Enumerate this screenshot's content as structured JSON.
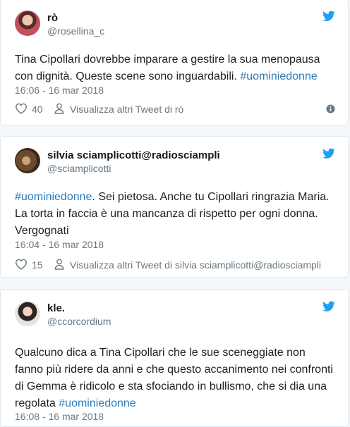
{
  "colors": {
    "link": "#2b7bb9",
    "twitter_blue": "#1da1f2",
    "muted": "#697882"
  },
  "icons": {
    "bird": "twitter-bird-icon",
    "like": "heart-icon",
    "profile": "person-icon",
    "info": "info-icon"
  },
  "tweets": [
    {
      "name": "rò",
      "handle": "@rosellina_c",
      "text_before": "Tina Cipollari dovrebbe imparare a gestire la sua menopausa con dignità. Queste scene sono inguardabili. ",
      "hashtag": "#uominiedonne",
      "text_after": "",
      "time": "16:06 - 16 mar 2018",
      "likes": "40",
      "more_link": "Visualizza altri Tweet di rò"
    },
    {
      "name": "silvia sciamplicotti@radiosciampli",
      "handle": "@sciamplicotti",
      "hashtag": "#uominiedonne",
      "text_after": ". Sei pietosa. Anche tu Cipollari ringrazia Maria. La torta in faccia è una mancanza di rispetto per ogni donna. Vergognati",
      "time": "16:04 - 16 mar 2018",
      "likes": "15",
      "more_link": "Visualizza altri Tweet di silvia sciamplicotti@radiosciampli"
    },
    {
      "name": "kle.",
      "handle": "@ccorcordium",
      "text_before": "Qualcuno dica a Tina Cipollari che le sue sceneggiate non fanno più ridere da anni e che questo accanimento nei confronti di Gemma è ridicolo e sta sfociando in bullismo, che si dia una regolata ",
      "hashtag": "#uominiedonne",
      "time": "16:08 - 16 mar 2018"
    }
  ]
}
